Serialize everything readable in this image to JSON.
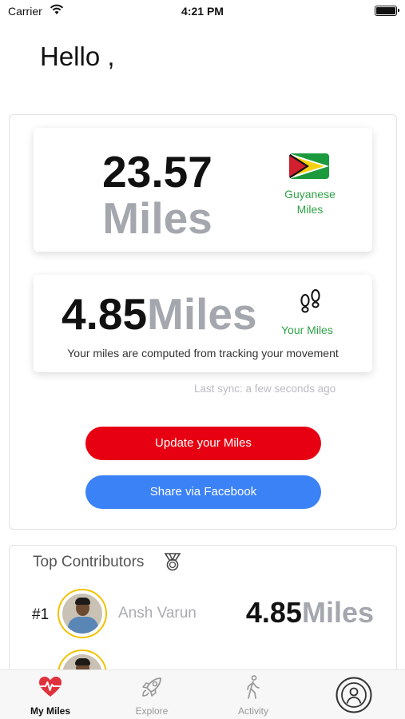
{
  "status_bar": {
    "carrier": "Carrier",
    "time": "4:21 PM"
  },
  "greeting": "Hello ,",
  "country_card": {
    "value": "23.57",
    "unit": "Miles",
    "label_line1": "Guyanese",
    "label_line2": "Miles",
    "flag_icon": "guyana-flag"
  },
  "user_card": {
    "value": "4.85",
    "unit": "Miles",
    "label": "Your Miles",
    "note": "Your miles are computed from tracking your movement",
    "icon": "footsteps-icon"
  },
  "sync_text": "Last sync: a few seconds ago",
  "buttons": {
    "update": "Update your Miles",
    "share": "Share via Facebook"
  },
  "contributors": {
    "title": "Top Contributors",
    "rows": [
      {
        "rank": "#1",
        "name": "Ansh Varun",
        "value": "4.85",
        "unit": "Miles"
      }
    ]
  },
  "tabs": [
    {
      "label": "My Miles",
      "icon": "heart-pulse-icon",
      "active": true
    },
    {
      "label": "Explore",
      "icon": "rocket-icon",
      "active": false
    },
    {
      "label": "Activity",
      "icon": "walking-person-icon",
      "active": false
    },
    {
      "label": "",
      "icon": "profile-icon",
      "active": false
    }
  ],
  "colors": {
    "accent_green": "#2fa347",
    "update_button": "#e60012",
    "share_button": "#3b82f6",
    "avatar_ring": "#f2c200",
    "active_tab_icon": "#e0323c"
  }
}
